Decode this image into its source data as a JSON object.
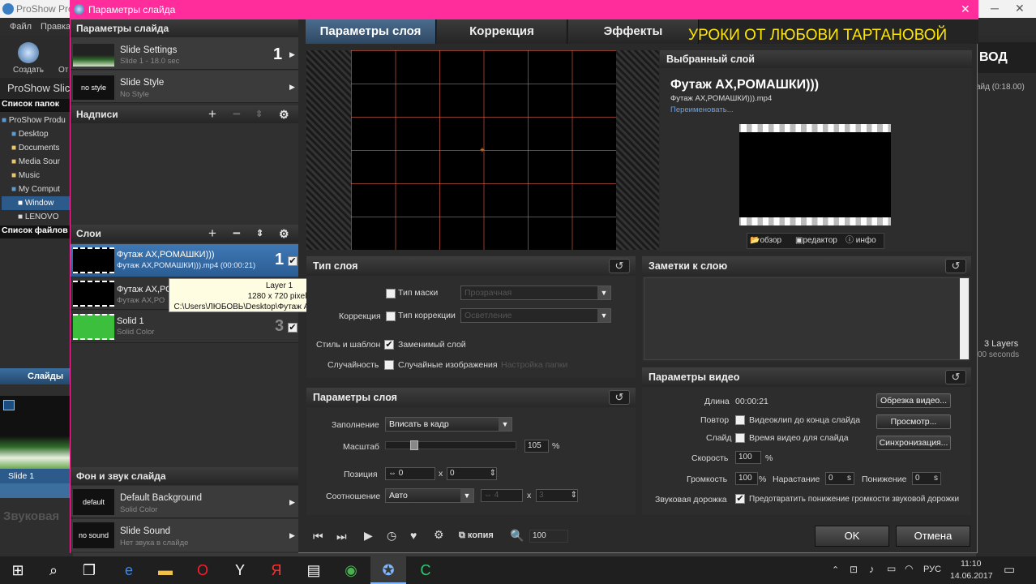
{
  "bg_app": {
    "title": "ProShow Pro",
    "menu": [
      "Файл",
      "Правка"
    ],
    "create_label": "Создать",
    "partial_label": "От",
    "proshow_label": "ProShow Slic",
    "folders_header": "Список папок",
    "folders": [
      "ProShow Produ",
      "Desktop",
      "Documents",
      "Media Sour",
      "Music",
      "My Comput",
      "Window",
      "LENOVO"
    ],
    "files_header": "Список файлов",
    "slides_label": "Слайды",
    "slide1_label": "Slide 1",
    "audio_label": "Звуковая",
    "right_header": "ВОД",
    "right_time": "айд (0:18.00)",
    "right_layers": "3 Layers",
    "right_seconds": "00 seconds"
  },
  "dialog": {
    "title": "Параметры слайда",
    "close_icon": "close-icon"
  },
  "left_panel": {
    "slide_params_header": "Параметры слайда",
    "slide_settings_title": "Slide Settings",
    "slide_settings_sub": "Slide 1 - 18.0 sec",
    "slide_settings_num": "1",
    "slide_style_thumb": "no style",
    "slide_style_title": "Slide Style",
    "slide_style_sub": "No Style",
    "captions_header": "Надписи",
    "layers_header": "Слои",
    "layers": [
      {
        "title": "Футаж АХ,РОМАШКИ)))",
        "sub": "Футаж АХ,РОМАШКИ))).mp4 (00:00:21)",
        "num": "1"
      },
      {
        "title": "Футаж АХ,РО",
        "sub": "Футаж АХ,РО",
        "num": "2"
      },
      {
        "title": "Solid 1",
        "sub": "Solid Color",
        "num": "3"
      }
    ],
    "tooltip": {
      "line1": "Layer 1",
      "line2": "1280 x 720 pixels",
      "line3": "C:\\Users\\ЛЮБОВЬ\\Desktop\\Футаж АХ,РОМАШКИ))).mp4"
    },
    "bg_sound_header": "Фон и звук слайда",
    "bg_thumb": "default",
    "bg_title": "Default Background",
    "bg_sub": "Solid Color",
    "sound_thumb": "no sound",
    "sound_title": "Slide Sound",
    "sound_sub": "Нет звука в слайде"
  },
  "tabs": [
    "Параметры слоя",
    "Коррекция",
    "Эффекты"
  ],
  "watermark": "УРОКИ ОТ ЛЮБОВИ ТАРТАНОВОЙ",
  "selected_layer": {
    "header": "Выбранный слой",
    "name": "Футаж АХ,РОМАШКИ)))",
    "file": "Футаж АХ,РОМАШКИ))).mp4",
    "rename": "Переименовать...",
    "buttons": [
      "обзор",
      "редактор",
      "инфо"
    ]
  },
  "layer_type": {
    "header": "Тип слоя",
    "mask_label": "Тип маски",
    "mask_value": "Прозрачная",
    "correction_left": "Коррекция",
    "correction_label": "Тип коррекции",
    "correction_value": "Осветление",
    "style_left": "Стиль и шаблон",
    "style_label": "Заменимый слой",
    "random_left": "Случайность",
    "random_label": "Случайные изображения",
    "random_folder": "Настройка папки"
  },
  "layer_params": {
    "header": "Параметры слоя",
    "fill_label": "Заполнение",
    "fill_value": "Вписать в кадр",
    "scale_label": "Масштаб",
    "scale_value": "105",
    "scale_unit": "%",
    "scale_fraction": 0.2,
    "pos_label": "Позиция",
    "pos_x": "0",
    "pos_sep": "x",
    "pos_y": "0",
    "ratio_label": "Соотношение",
    "ratio_value": "Авто",
    "ratio_w": "4",
    "ratio_h": "3"
  },
  "notes": {
    "header": "Заметки к слою"
  },
  "video_params": {
    "header": "Параметры видео",
    "length_label": "Длина",
    "length_value": "00:00:21",
    "trim_btn": "Обрезка видео...",
    "repeat_label": "Повтор",
    "repeat_text": "Видеоклип до конца слайда",
    "preview_btn": "Просмотр...",
    "slide_label": "Слайд",
    "slide_text": "Время видео для слайда",
    "sync_btn": "Синхронизация...",
    "speed_label": "Скорость",
    "speed_value": "100",
    "speed_unit": "%",
    "volume_label": "Громкость",
    "volume_value": "100",
    "volume_unit": "%",
    "fadein_label": "Нарастание",
    "fadein_value": "0",
    "fadein_unit": "s",
    "fadeout_label": "Понижение",
    "fadeout_value": "0",
    "fadeout_unit": "s",
    "track_label": "Звуковая дорожка",
    "track_text": "Предотвратить понижение громкости звуковой дорожки"
  },
  "bottom_bar": {
    "copy_label": "копия",
    "zoom_value": "100",
    "ok": "OK",
    "cancel": "Отмена"
  },
  "taskbar": {
    "lang": "РУС",
    "time": "11:10",
    "date": "14.06.2017"
  },
  "colors": {
    "accent_pink": "#ff2d9c",
    "tab_active": "#3a5a7c",
    "watermark": "#ffe600",
    "solid_green": "#3cbf3c"
  }
}
